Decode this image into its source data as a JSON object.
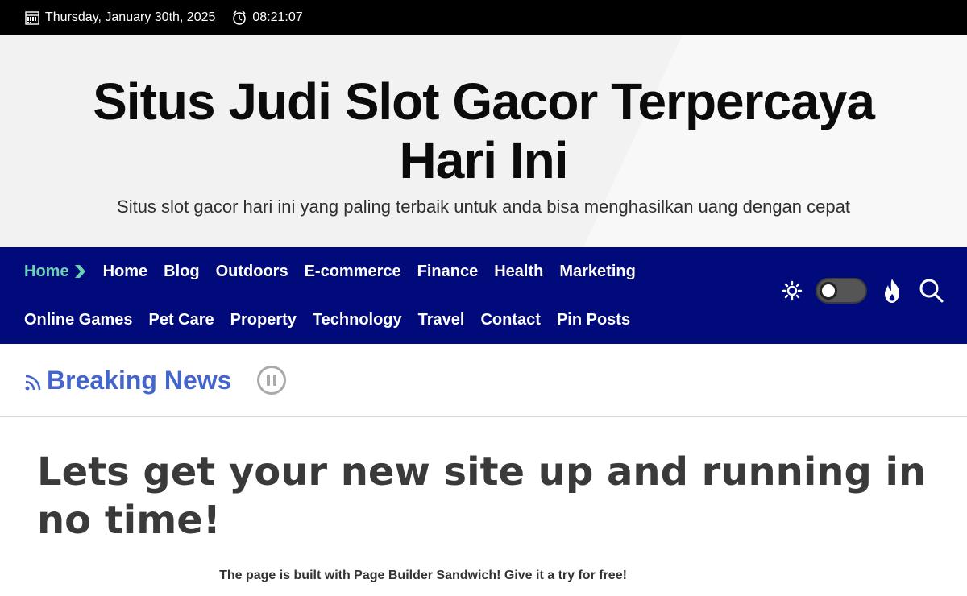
{
  "topbar": {
    "date": "Thursday, January 30th, 2025",
    "time": "08:21:07"
  },
  "header": {
    "title": "Situs Judi Slot Gacor Terpercaya Hari Ini",
    "tagline": "Situs slot gacor hari ini yang paling terbaik untuk anda bisa menghasilkan uang dengan cepat"
  },
  "nav": {
    "row1": [
      "Home",
      "Home",
      "Blog",
      "Outdoors",
      "E-commerce",
      "Finance",
      "Health",
      "Marketing"
    ],
    "row2": [
      "Online Games",
      "Pet Care",
      "Property",
      "Technology",
      "Travel",
      "Contact",
      "Pin Posts"
    ]
  },
  "breaking": {
    "title": "Breaking News"
  },
  "main": {
    "heading": "Lets get your new site up and running in no time!",
    "subtext": "The page is built with Page Builder Sandwich! Give it a try for free!"
  },
  "colors": {
    "nav_bg": "#000a7a",
    "active_link": "#6ad3b3",
    "breaking_title": "#4466cc"
  }
}
